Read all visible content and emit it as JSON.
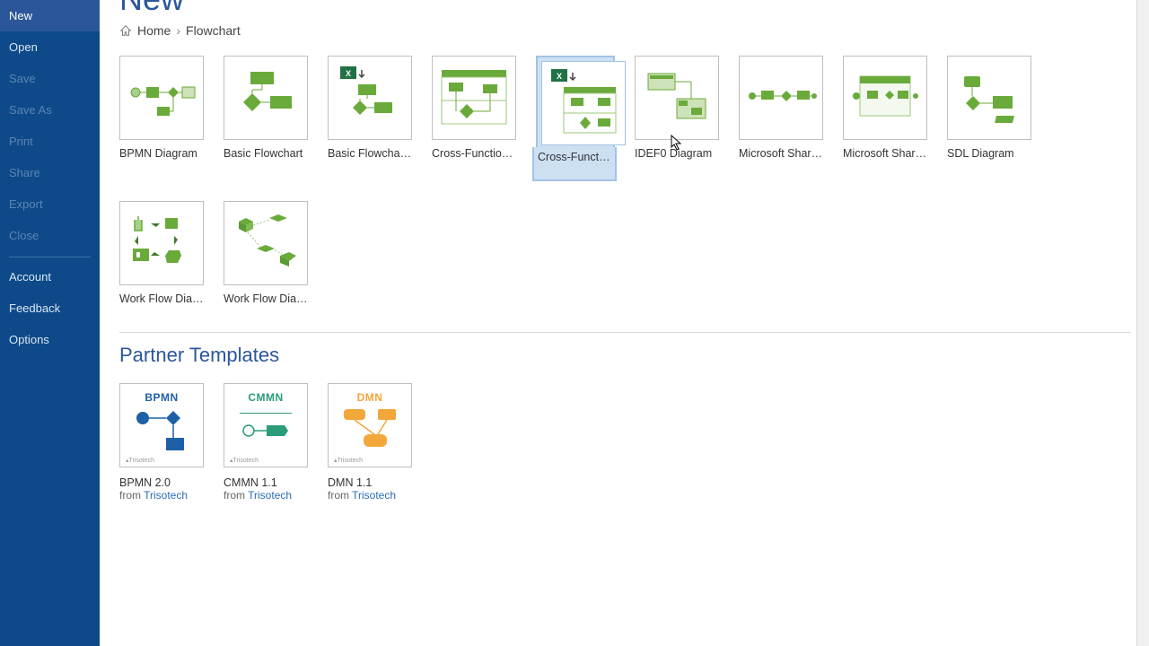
{
  "sidebar": {
    "items": [
      {
        "label": "New",
        "state": "active"
      },
      {
        "label": "Open",
        "state": "normal"
      },
      {
        "label": "Save",
        "state": "disabled"
      },
      {
        "label": "Save As",
        "state": "disabled"
      },
      {
        "label": "Print",
        "state": "disabled"
      },
      {
        "label": "Share",
        "state": "disabled"
      },
      {
        "label": "Export",
        "state": "disabled"
      },
      {
        "label": "Close",
        "state": "disabled"
      }
    ],
    "bottom_items": [
      {
        "label": "Account"
      },
      {
        "label": "Feedback"
      },
      {
        "label": "Options"
      }
    ]
  },
  "page": {
    "title": "New"
  },
  "breadcrumb": {
    "home": "Home",
    "items": [
      "Flowchart"
    ]
  },
  "templates": [
    {
      "label": "BPMN Diagram",
      "icon": "bpmn"
    },
    {
      "label": "Basic Flowchart",
      "icon": "basic"
    },
    {
      "label": "Basic Flowchart...",
      "icon": "basic-xl"
    },
    {
      "label": "Cross-Functional...",
      "icon": "cross"
    },
    {
      "label": "Cross-Functional...",
      "icon": "cross-xl",
      "selected": true
    },
    {
      "label": "IDEF0 Diagram",
      "icon": "idef0"
    },
    {
      "label": "Microsoft Share...",
      "icon": "share1"
    },
    {
      "label": "Microsoft Share...",
      "icon": "share2"
    },
    {
      "label": "SDL Diagram",
      "icon": "sdl"
    },
    {
      "label": "Work Flow Diagr...",
      "icon": "work1"
    },
    {
      "label": "Work Flow Diagr...",
      "icon": "work2"
    }
  ],
  "partner_section": {
    "title": "Partner Templates"
  },
  "partner_templates": [
    {
      "head": "BPMN",
      "head_color": "#1e5fa8",
      "label": "BPMN 2.0",
      "from": "from ",
      "link": "Trisotech",
      "icon": "p-bpmn"
    },
    {
      "head": "CMMN",
      "head_color": "#2a9c7a",
      "label": "CMMN 1.1",
      "from": "from ",
      "link": "Trisotech",
      "icon": "p-cmmn"
    },
    {
      "head": "DMN",
      "head_color": "#f2a73b",
      "label": "DMN 1.1",
      "from": "from ",
      "link": "Trisotech",
      "icon": "p-dmn"
    }
  ]
}
